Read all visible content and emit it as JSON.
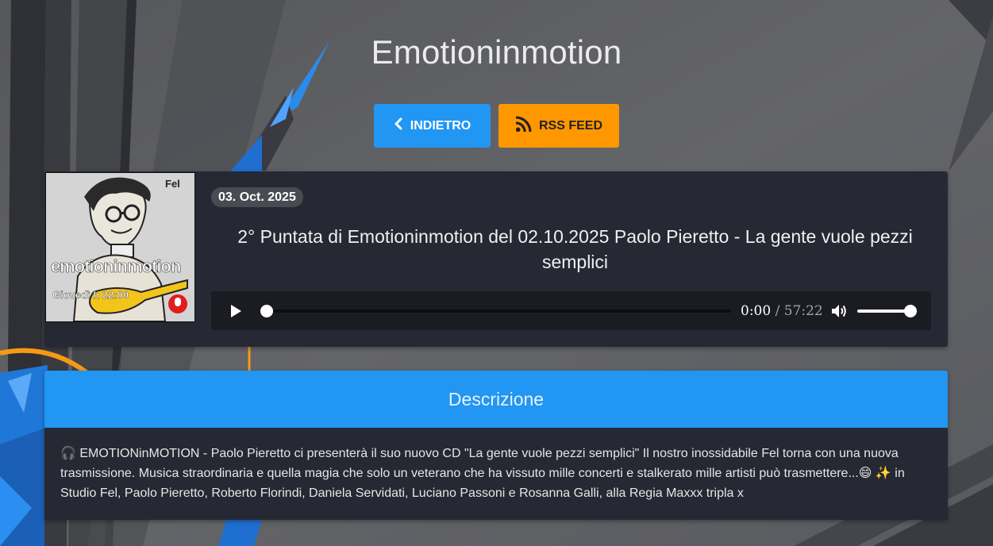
{
  "page": {
    "title": "Emotioninmotion"
  },
  "actions": {
    "back_label": "INDIETRO",
    "rss_label": "RSS FEED"
  },
  "episode": {
    "date": "03. Oct. 2025",
    "title": "2° Puntata di Emotioninmotion del 02.10.2025 Paolo Pieretto - La gente vuole pezzi semplici",
    "cover": {
      "host_label": "Fel",
      "show_logo": "emotioninmotion",
      "schedule": "Giovedì h 22:00"
    }
  },
  "player": {
    "current_time": "0:00",
    "separator": "/",
    "duration": "57:22",
    "progress_fraction": 0,
    "volume_fraction": 1
  },
  "description": {
    "header": "Descrizione",
    "text": "🎧 EMOTIONinMOTION - Paolo Pieretto ci presenterà il suo nuovo CD \"La gente vuole pezzi semplici\" Il nostro inossidabile Fel torna con una nuova trasmissione. Musica straordinaria e quella magia che solo un veterano che ha vissuto mille concerti e stalkerato mille artisti può trasmettere...😄 ✨ in Studio Fel, Paolo Pieretto, Roberto Florindi, Daniela Servidati, Luciano Passoni e Rosanna Galli, alla Regia Maxxx tripla x"
  },
  "colors": {
    "primary": "#2196f3",
    "rss": "#ff9800",
    "card": "#262833",
    "background": "#5e5f63"
  },
  "icons": {
    "back": "chevron-left-icon",
    "rss": "rss-icon",
    "play": "play-icon",
    "volume": "volume-icon"
  }
}
